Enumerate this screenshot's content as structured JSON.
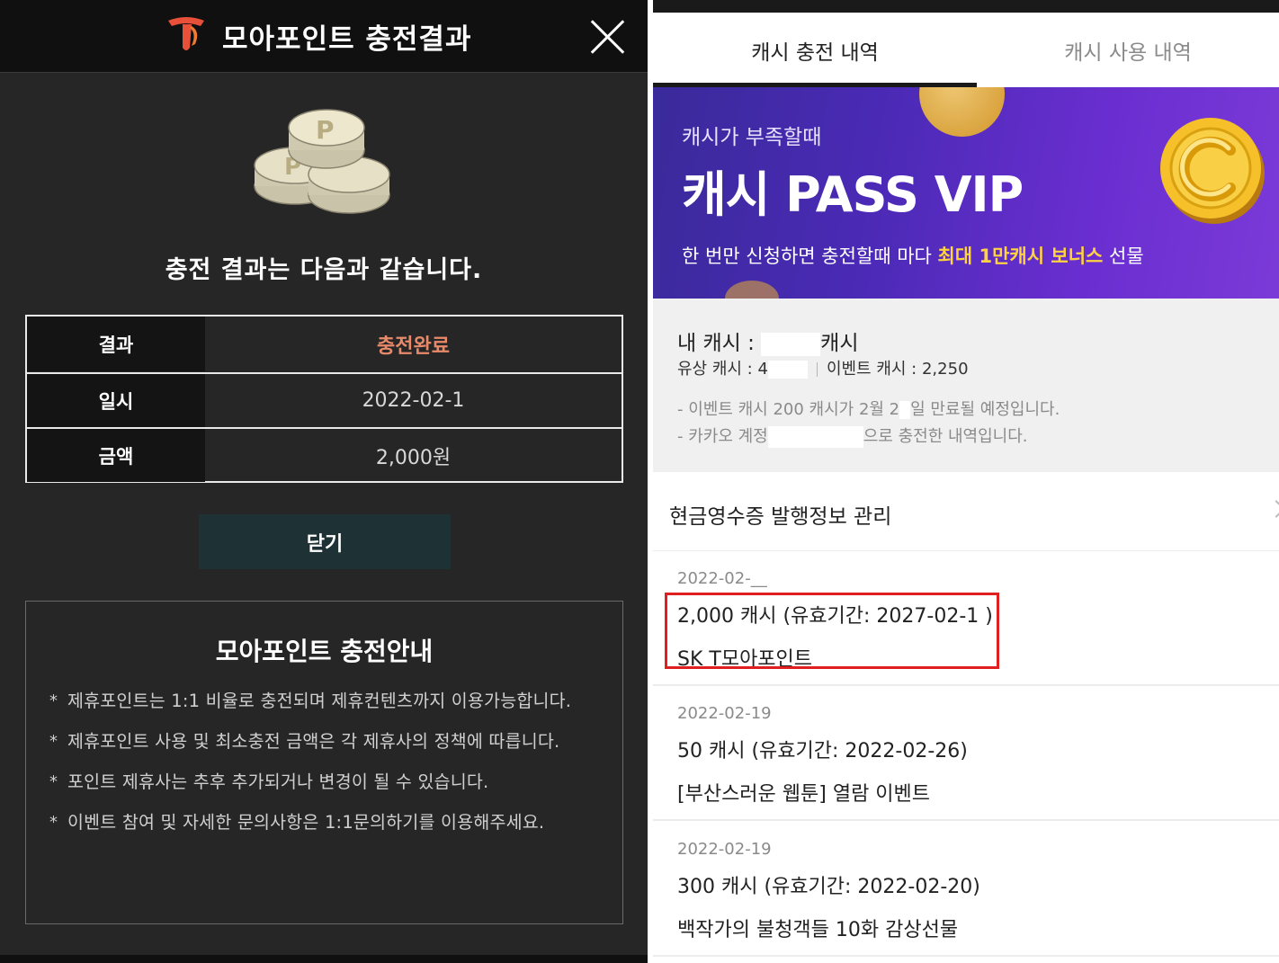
{
  "left_panel": {
    "title": "모아포인트 충전결과",
    "lead_text": "충전 결과는 다음과 같습니다.",
    "result_table": [
      {
        "label": "결과",
        "value": "충전완료"
      },
      {
        "label": "일시",
        "value": "2022-02-1"
      },
      {
        "label": "금액",
        "value": "2,000원"
      }
    ],
    "close_button": "닫기",
    "guide": {
      "title": "모아포인트 충전안내",
      "items": [
        "제휴포인트는 1:1 비율로 충전되며 제휴컨텐츠까지 이용가능합니다.",
        "제휴포인트 사용 및 최소충전 금액은 각 제휴사의 정책에 따릅니다.",
        "포인트 제휴사는 추후 추가되거나 변경이 될 수 있습니다.",
        "이벤트 참여 및 자세한 문의사항은 1:1문의하기를 이용해주세요."
      ]
    },
    "colors": {
      "accent": "#e88a6a",
      "button_bg": "#1e3236",
      "panel_bg": "#262626"
    }
  },
  "right_panel": {
    "tabs": [
      {
        "label": "캐시 충전 내역",
        "active": true
      },
      {
        "label": "캐시 사용 내역",
        "active": false
      }
    ],
    "banner": {
      "subtitle": "캐시가 부족할때",
      "title": "캐시 PASS VIP",
      "desc_prefix": "한 번만 신청하면 충전할때 마다 ",
      "desc_highlight": "최대 1만캐시 보너스",
      "desc_suffix": " 선물"
    },
    "cash": {
      "my_cash_label": "내 캐시 :",
      "my_cash_unit": "캐시",
      "paid_label": "유상 캐시 :",
      "paid_value": "4",
      "event_label": "이벤트 캐시 :",
      "event_value": "2,250",
      "note1_prefix": "- 이벤트 캐시 200 캐시가 2월 2",
      "note1_suffix": "일 만료될 예정입니다.",
      "note2_prefix": "- 카카오 계정",
      "note2_suffix": "으로 충전한 내역입니다."
    },
    "receipt_label": "현금영수증 발행정보 관리",
    "entries": [
      {
        "date": "2022-02-__",
        "amount": "2,000 캐시 (유효기간: 2027-02-1   )",
        "source": "SK T모아포인트",
        "highlighted": true
      },
      {
        "date": "2022-02-19",
        "amount": "50 캐시 (유효기간: 2022-02-26)",
        "source": "[부산스러운 웹툰] 열람 이벤트",
        "highlighted": false
      },
      {
        "date": "2022-02-19",
        "amount": "300 캐시 (유효기간: 2022-02-20)",
        "source": "백작가의 불청객들 10화 감상선물",
        "highlighted": false
      }
    ],
    "colors": {
      "highlight_border": "#e02020",
      "banner_highlight": "#ffd23f"
    }
  }
}
